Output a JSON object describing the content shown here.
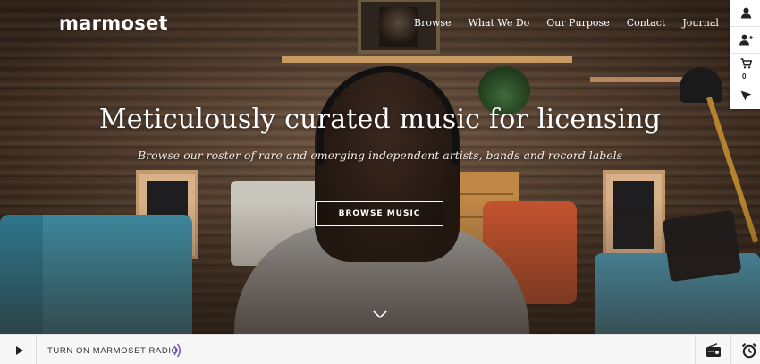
{
  "brand": {
    "logo_text": "marmoset"
  },
  "nav": {
    "items": [
      {
        "label": "Browse"
      },
      {
        "label": "What We Do"
      },
      {
        "label": "Our Purpose"
      },
      {
        "label": "Contact"
      },
      {
        "label": "Journal"
      }
    ]
  },
  "hero": {
    "headline": "Meticulously curated music for licensing",
    "subhead": "Browse our roster of rare and emerging independent artists, bands and record labels",
    "cta_label": "BROWSE MUSIC",
    "scroll_icon": "chevron-down-icon"
  },
  "toolbar": {
    "items": [
      {
        "icon": "user-icon"
      },
      {
        "icon": "add-user-icon"
      },
      {
        "icon": "cart-icon",
        "count": "0"
      },
      {
        "icon": "send-icon"
      }
    ]
  },
  "player": {
    "play_icon": "play-icon",
    "radio_label": "TURN ON MARMOSET RADIO",
    "radio_wave_icon": "radio-wave-icon",
    "right_icons": [
      "radio-icon",
      "alarm-clock-icon"
    ]
  },
  "colors": {
    "accent_purple": "#7b5cc9",
    "text_white": "#ffffff",
    "player_bg": "#f7f7f7"
  }
}
